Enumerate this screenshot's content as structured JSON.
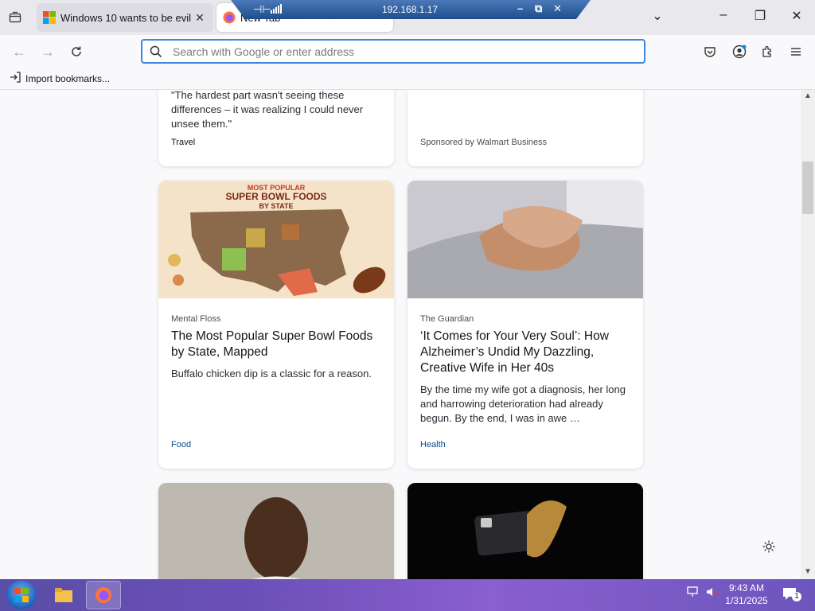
{
  "tabs": [
    {
      "title": "Windows 10 wants to be evil",
      "favicon": "windows-logo-icon"
    },
    {
      "title": "New Tab",
      "favicon": "firefox-icon"
    }
  ],
  "remote_bar": {
    "address": "192.168.1.17"
  },
  "urlbar": {
    "placeholder": "Search with Google or enter address",
    "value": ""
  },
  "bookmarks": {
    "import_label": "Import bookmarks..."
  },
  "cards": [
    {
      "excerpt_tail": "\"The hardest part wasn't seeing these differences – it was realizing I could never unsee them.\"",
      "category": "Travel"
    },
    {
      "sponsor": "Sponsored by Walmart Business"
    },
    {
      "publisher": "Mental Floss",
      "headline": "The Most Popular Super Bowl Foods by State, Mapped",
      "excerpt": "Buffalo chicken dip is a classic for a reason.",
      "category": "Food",
      "image_title_line1": "MOST POPULAR",
      "image_title_line2": "SUPER BOWL FOODS",
      "image_title_line3": "BY STATE"
    },
    {
      "publisher": "The Guardian",
      "headline": "‘It Comes for Your Very Soul’: How Alzheimer’s Undid My Dazzling, Creative Wife in Her 40s",
      "excerpt": "By the time my wife got a diagnosis, her long and harrowing deterioration had already begun. By the end, I was in awe …",
      "category": "Health"
    }
  ],
  "clock": {
    "time": "9:43 AM",
    "date": "1/31/2025"
  },
  "notifications": {
    "count": "1"
  },
  "colors": {
    "accent": "#3b86d9",
    "category": "#0e4b8f",
    "taskbar": "#6b4fb8"
  }
}
